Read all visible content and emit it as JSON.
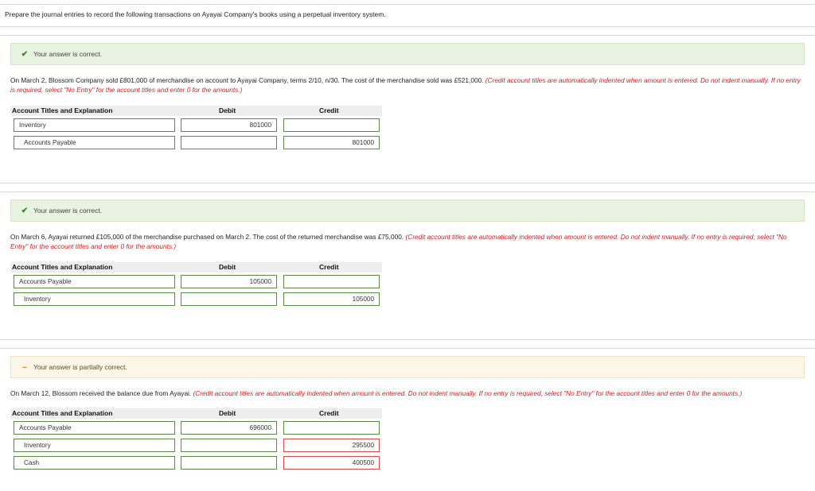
{
  "intro": "Prepare the journal entries to record the following transactions on Ayayai Company's books using a perpetual inventory system.",
  "colors": {
    "correct_bg": "#e9f3e1",
    "partial_bg": "#fbf6e6",
    "hint": "#d11f1f",
    "correct_border": "#5b8a47",
    "incorrect_border": "#d44c4c"
  },
  "icons": {
    "correct": "check-icon",
    "partial": "dash-icon"
  },
  "headers": {
    "account": "Account Titles and Explanation",
    "debit": "Debit",
    "credit": "Credit"
  },
  "sections": [
    {
      "status": "Your answer is correct.",
      "question": "On March 2, Blossom Company sold £801,000 of merchandise on account to Ayayai Company, terms 2/10, n/30. The cost of the merchandise sold was £521,000.",
      "hint": "(Credit account titles are automatically indented when amount is entered. Do not indent manually. If no entry is required, select \"No Entry\" for the account titles and enter 0 for the amounts.)",
      "rows": [
        {
          "account": "Inventory",
          "debit": "801000",
          "credit": ""
        },
        {
          "account": "Accounts Payable",
          "debit": "",
          "credit": "801000"
        }
      ]
    },
    {
      "status": "Your answer is correct.",
      "question": "On March 6, Ayayai returned £105,000 of the merchandise purchased on March 2. The cost of the returned merchandise was £75,000.",
      "hint": "(Credit account titles are automatically indented when amount is entered. Do not indent manually. If no entry is required, select \"No Entry\" for the account titles and enter 0 for the amounts.)",
      "rows": [
        {
          "account": "Accounts Payable",
          "debit": "105000",
          "credit": ""
        },
        {
          "account": "Inventory",
          "debit": "",
          "credit": "105000"
        }
      ]
    },
    {
      "status": "Your answer is partially correct.",
      "question": "On March 12, Blossom received the balance due from Ayayai.",
      "hint": "(Credit account titles are automatically indented when amount is entered. Do not indent manually. If no entry is required, select \"No Entry\" for the account titles and enter 0 for the amounts.)",
      "rows": [
        {
          "account": "Accounts Payable",
          "debit": "696000",
          "credit": ""
        },
        {
          "account": "Inventory",
          "debit": "",
          "credit": "295500"
        },
        {
          "account": "Cash",
          "debit": "",
          "credit": "400500"
        }
      ]
    }
  ]
}
